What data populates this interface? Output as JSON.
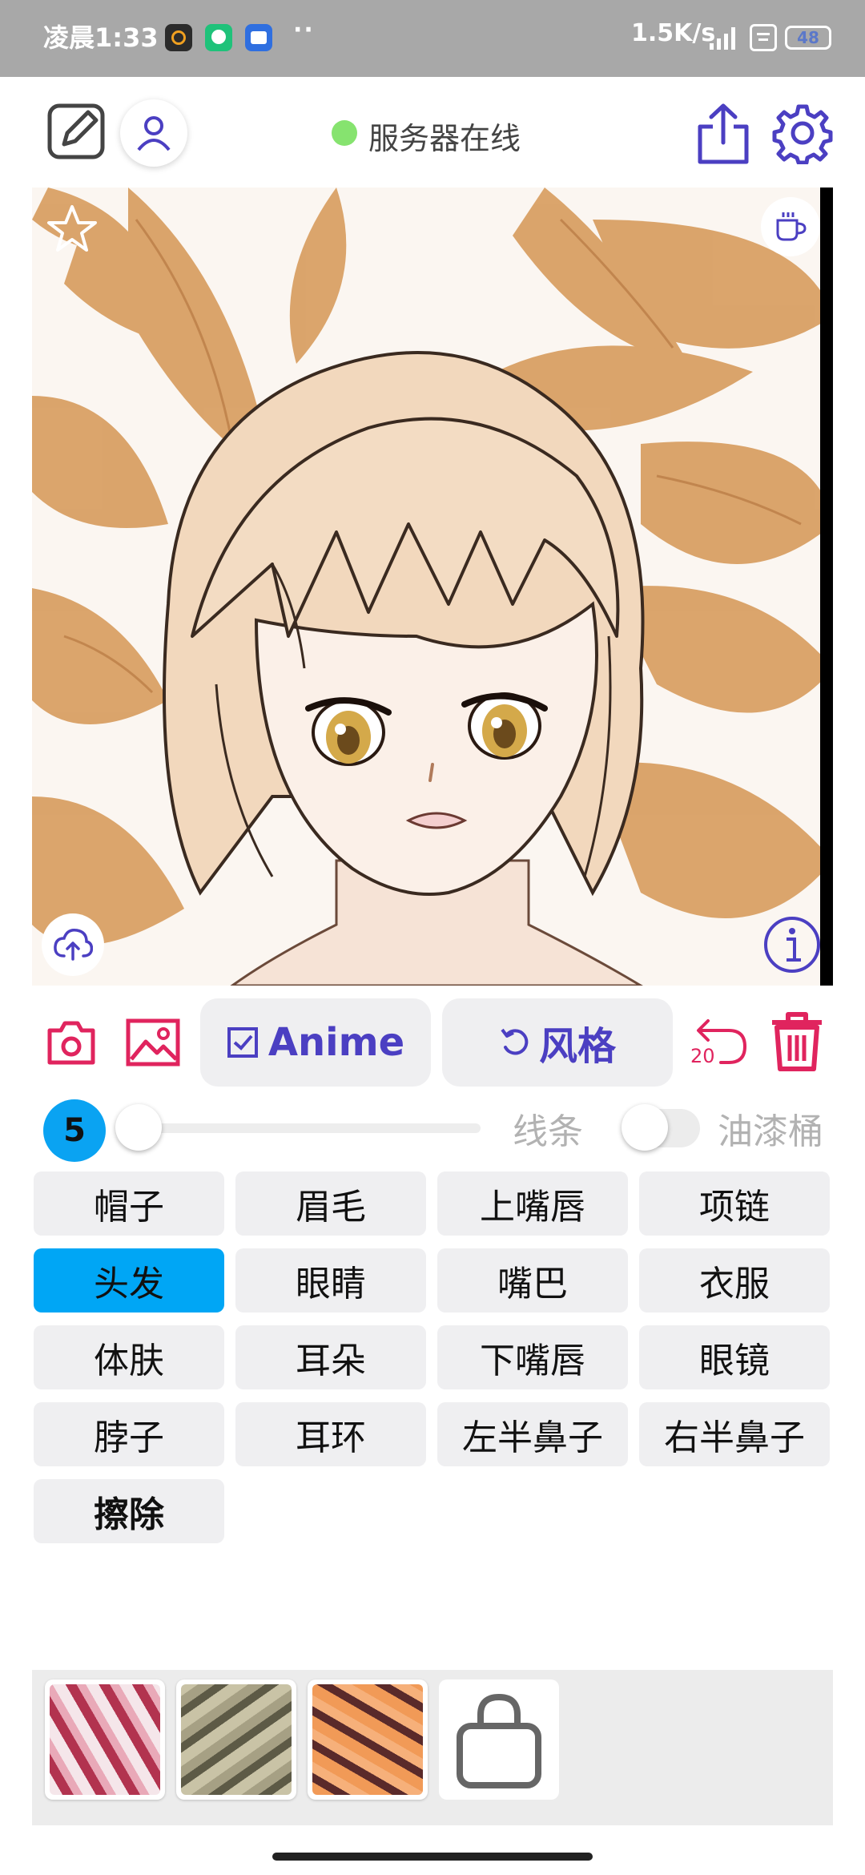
{
  "status_bar": {
    "time": "凌晨1:33",
    "dots": "··",
    "network_speed": "1.5K/s",
    "battery": "48"
  },
  "toolbar": {
    "server_status": "服务器在线",
    "server_status_color": "#86e36f"
  },
  "actions": {
    "model_label": "Anime",
    "style_label": "风格",
    "undo_count": "20",
    "accent_color": "#e0245e",
    "brand_color": "#4b3fc2"
  },
  "brush": {
    "size": "5",
    "line_label": "线条",
    "paint_bucket_label": "油漆桶"
  },
  "parts": [
    {
      "label": "帽子"
    },
    {
      "label": "眉毛"
    },
    {
      "label": "上嘴唇"
    },
    {
      "label": "项链"
    },
    {
      "label": "头发"
    },
    {
      "label": "眼睛"
    },
    {
      "label": "嘴巴"
    },
    {
      "label": "衣服"
    },
    {
      "label": "体肤"
    },
    {
      "label": "耳朵"
    },
    {
      "label": "下嘴唇"
    },
    {
      "label": "眼镜"
    },
    {
      "label": "脖子"
    },
    {
      "label": "耳环"
    },
    {
      "label": "左半鼻子"
    },
    {
      "label": "右半鼻子"
    },
    {
      "label": "擦除"
    }
  ],
  "selected_part": "头发",
  "palette_swatches": [
    "red-texture",
    "olive-texture",
    "orange-texture",
    "locked-slot"
  ]
}
